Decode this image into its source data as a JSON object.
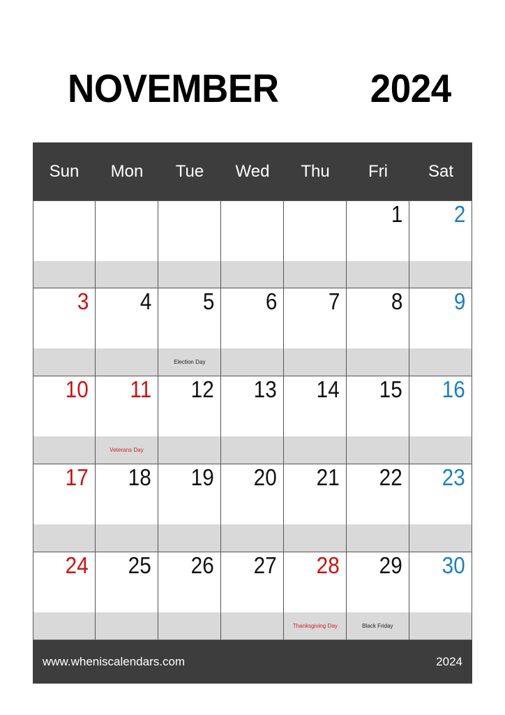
{
  "title": {
    "month": "NOVEMBER",
    "year": "2024"
  },
  "colors": {
    "header_bg": "#3d3d3d",
    "event_band": "#d9d9d9",
    "sunday_red": "#cc1111",
    "saturday_blue": "#1a7fc4",
    "weekday_black": "#111111",
    "grid_line": "#555555",
    "page_bg": "#ffffff"
  },
  "weekdays": [
    "Sun",
    "Mon",
    "Tue",
    "Wed",
    "Thu",
    "Fri",
    "Sat"
  ],
  "weeks": [
    [
      {
        "day": "",
        "event": "",
        "kind": "empty"
      },
      {
        "day": "",
        "event": "",
        "kind": "empty"
      },
      {
        "day": "",
        "event": "",
        "kind": "empty"
      },
      {
        "day": "",
        "event": "",
        "kind": "empty"
      },
      {
        "day": "",
        "event": "",
        "kind": "empty"
      },
      {
        "day": "1",
        "event": "",
        "kind": "weekday"
      },
      {
        "day": "2",
        "event": "",
        "kind": "saturday"
      }
    ],
    [
      {
        "day": "3",
        "event": "",
        "kind": "sunday"
      },
      {
        "day": "4",
        "event": "",
        "kind": "weekday"
      },
      {
        "day": "5",
        "event": "Election Day",
        "kind": "weekday"
      },
      {
        "day": "6",
        "event": "",
        "kind": "weekday"
      },
      {
        "day": "7",
        "event": "",
        "kind": "weekday"
      },
      {
        "day": "8",
        "event": "",
        "kind": "weekday"
      },
      {
        "day": "9",
        "event": "",
        "kind": "saturday"
      }
    ],
    [
      {
        "day": "10",
        "event": "",
        "kind": "sunday"
      },
      {
        "day": "11",
        "event": "Veterans Day",
        "kind": "holiday"
      },
      {
        "day": "12",
        "event": "",
        "kind": "weekday"
      },
      {
        "day": "13",
        "event": "",
        "kind": "weekday"
      },
      {
        "day": "14",
        "event": "",
        "kind": "weekday"
      },
      {
        "day": "15",
        "event": "",
        "kind": "weekday"
      },
      {
        "day": "16",
        "event": "",
        "kind": "saturday"
      }
    ],
    [
      {
        "day": "17",
        "event": "",
        "kind": "sunday"
      },
      {
        "day": "18",
        "event": "",
        "kind": "weekday"
      },
      {
        "day": "19",
        "event": "",
        "kind": "weekday"
      },
      {
        "day": "20",
        "event": "",
        "kind": "weekday"
      },
      {
        "day": "21",
        "event": "",
        "kind": "weekday"
      },
      {
        "day": "22",
        "event": "",
        "kind": "weekday"
      },
      {
        "day": "23",
        "event": "",
        "kind": "saturday"
      }
    ],
    [
      {
        "day": "24",
        "event": "",
        "kind": "sunday"
      },
      {
        "day": "25",
        "event": "",
        "kind": "weekday"
      },
      {
        "day": "26",
        "event": "",
        "kind": "weekday"
      },
      {
        "day": "27",
        "event": "",
        "kind": "weekday"
      },
      {
        "day": "28",
        "event": "Thanksgiving Day",
        "kind": "holiday"
      },
      {
        "day": "29",
        "event": "Black Friday",
        "kind": "weekday"
      },
      {
        "day": "30",
        "event": "",
        "kind": "saturday"
      }
    ]
  ],
  "footer": {
    "site": "www.wheniscalendars.com",
    "year": "2024"
  }
}
